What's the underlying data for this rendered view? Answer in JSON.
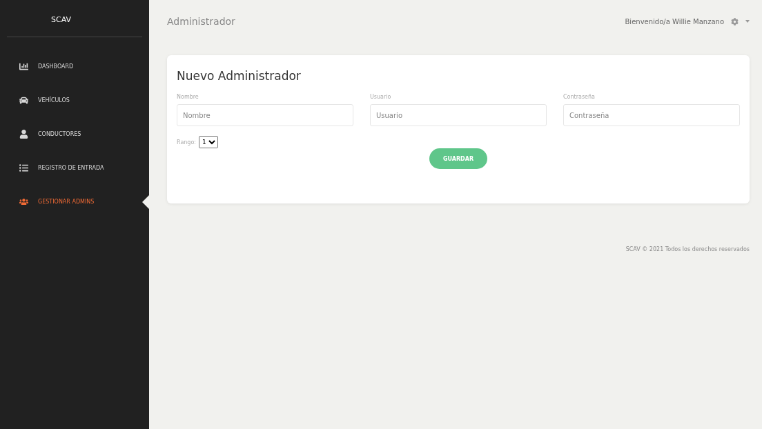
{
  "sidebar": {
    "brand": "SCAV",
    "items": [
      {
        "kind": "chart",
        "label": "DASHBOARD",
        "selected": false
      },
      {
        "kind": "car",
        "label": "VEHÍCULOS",
        "selected": false
      },
      {
        "kind": "person",
        "label": "CONDUCTORES",
        "selected": false
      },
      {
        "kind": "list",
        "label": "REGISTRO DE ENTRADA",
        "selected": false
      },
      {
        "kind": "group",
        "label": "GESTIONAR ADMINS",
        "selected": true
      }
    ]
  },
  "header": {
    "title": "Administrador",
    "welcome": "Bienvenido/a Willie Manzano"
  },
  "form": {
    "title": "Nuevo Administrador",
    "fields": [
      {
        "label": "Nombre",
        "placeholder": "Nombre"
      },
      {
        "label": "Usuario",
        "placeholder": "Usuario"
      },
      {
        "label": "Contraseña",
        "placeholder": "Contraseña"
      }
    ],
    "rank": {
      "label": "Rango:",
      "value": "1"
    },
    "submit": "GUARDAR"
  },
  "footer": "SCAV © 2021 Todos los derechos reservados"
}
